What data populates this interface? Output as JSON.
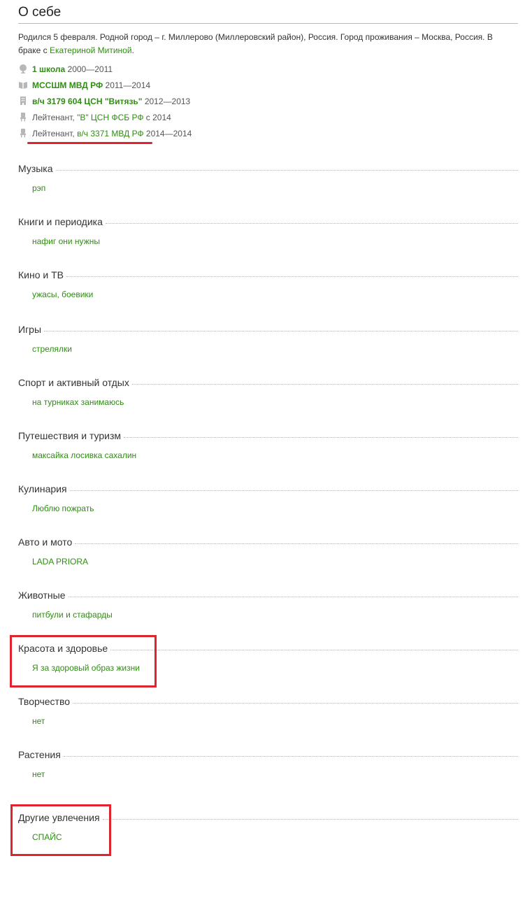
{
  "about": {
    "title": "О себе",
    "bio_text": "Родился 5 февраля. Родной город – г. Миллерово (Миллеровский район), Россия. Город проживания – Москва, Россия. В браке с ",
    "spouse_link": "Екатериной Митиной",
    "bio_end": "."
  },
  "career": [
    {
      "icon": "globe-icon",
      "prefix": "",
      "link": "1 школа",
      "years": " 2000—2011"
    },
    {
      "icon": "book-icon",
      "prefix": "",
      "link": "МССШМ МВД РФ",
      "years": " 2011—2014"
    },
    {
      "icon": "building-icon",
      "prefix": "",
      "link": "в/ч 3179 604 ЦСН \"Витязь\"",
      "years": " 2012—2013"
    },
    {
      "icon": "chair-icon",
      "prefix": "Лейтенант, ",
      "link": "\"В\" ЦСН ФСБ РФ",
      "years": " с 2014"
    },
    {
      "icon": "chair-icon",
      "prefix": "Лейтенант, ",
      "link": "в/ч 3371 МВД РФ",
      "years": " 2014—2014"
    }
  ],
  "interests": [
    {
      "title": "Музыка",
      "value": "рэп"
    },
    {
      "title": "Книги и периодика",
      "value": "нафиг они нужны"
    },
    {
      "title": "Кино и ТВ",
      "value": "ужасы, боевики"
    },
    {
      "title": "Игры",
      "value": "стрелялки"
    },
    {
      "title": "Спорт и активный отдых",
      "value": "на турниках занимаюсь"
    },
    {
      "title": "Путешествия и туризм",
      "value": "максайка лосивка сахалин"
    },
    {
      "title": "Кулинария",
      "value": "Люблю пожрать"
    },
    {
      "title": "Авто и мото",
      "value": "LADA PRIORA"
    },
    {
      "title": "Животные",
      "value": "питбули и стафарды"
    },
    {
      "title": "Красота и здоровье",
      "value": "Я за здоровый образ жизни"
    },
    {
      "title": "Творчество",
      "value": "нет"
    },
    {
      "title": "Растения",
      "value": "нет"
    },
    {
      "title": "Другие увлечения",
      "value": "СПАЙС"
    }
  ],
  "colors": {
    "link": "#2e8e10",
    "highlight": "#e0242d"
  }
}
